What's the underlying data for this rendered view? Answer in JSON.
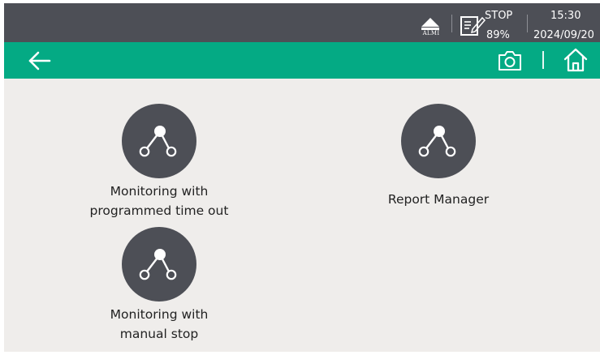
{
  "status": {
    "alarm_label": "ALMI",
    "run_state": "STOP",
    "battery": "89%",
    "time": "15:30",
    "date": "2024/09/20"
  },
  "colors": {
    "status_bar": "#4d4f56",
    "toolbar": "#04aa84",
    "background": "#efedeb",
    "tile_circle": "#4d4f56"
  },
  "toolbar": {
    "back_icon": "arrow-left-icon",
    "camera_icon": "camera-icon",
    "home_icon": "home-icon"
  },
  "tiles": [
    {
      "label_lines": [
        "Monitoring with",
        "programmed time out"
      ],
      "icon": "node-tree-icon"
    },
    {
      "label_lines": [
        "Report Manager"
      ],
      "icon": "node-tree-icon"
    },
    {
      "label_lines": [
        "Monitoring with",
        "manual stop"
      ],
      "icon": "node-tree-icon"
    }
  ]
}
